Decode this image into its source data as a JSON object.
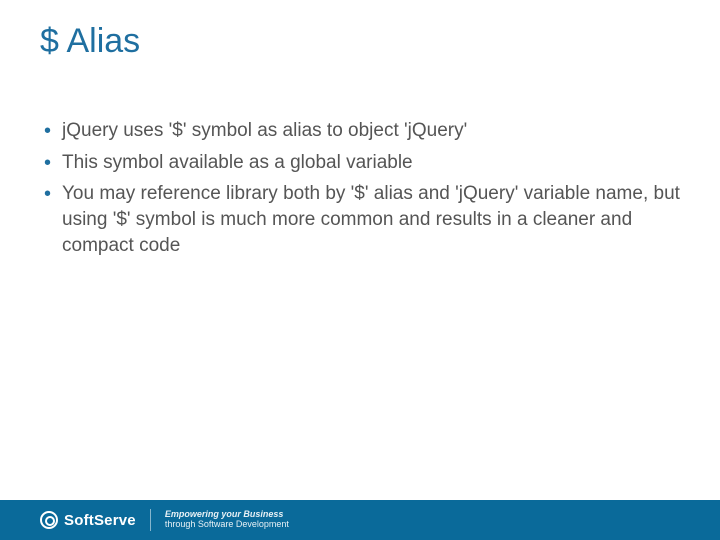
{
  "title": "$ Alias",
  "bullets": [
    "jQuery uses '$' symbol as alias to object 'jQuery'",
    "This symbol available as a global variable",
    "You may reference library both by '$' alias and 'jQuery' variable name, but using '$' symbol is much more common and results in a cleaner and compact code"
  ],
  "footer": {
    "brand": "SoftServe",
    "tagline_line1": "Empowering your Business",
    "tagline_line2": "through Software Development"
  }
}
